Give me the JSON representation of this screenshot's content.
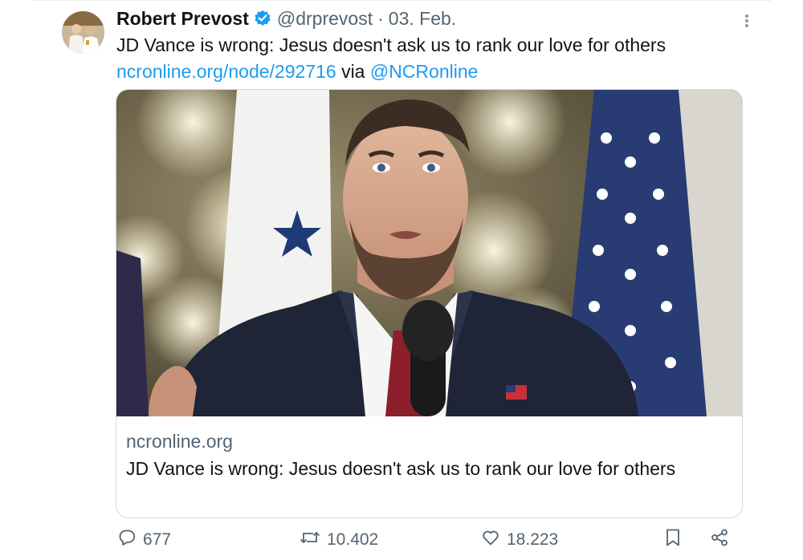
{
  "author": {
    "name": "Robert Prevost",
    "handle": "@drprevost",
    "separator": "·",
    "date": "03. Feb."
  },
  "tweet": {
    "text_line1": "JD Vance is wrong: Jesus doesn't ask us to rank our love for others",
    "link_url": "ncronline.org/node/292716",
    "via_word": "via",
    "via_handle": "@NCRonline"
  },
  "card": {
    "domain": "ncronline.org",
    "title": "JD Vance is wrong: Jesus doesn't ask us to rank our love for others"
  },
  "actions": {
    "replies": "677",
    "reposts": "10.402",
    "likes": "18.223"
  },
  "icons": {
    "verified": "verified-badge-icon",
    "more": "more-vertical-icon",
    "reply": "reply-icon",
    "repost": "repost-icon",
    "like": "heart-icon",
    "bookmark": "bookmark-icon",
    "share": "share-icon"
  },
  "colors": {
    "accent": "#1d9bf0",
    "text": "#0f1419",
    "muted": "#536471",
    "border": "#cfd9de"
  }
}
